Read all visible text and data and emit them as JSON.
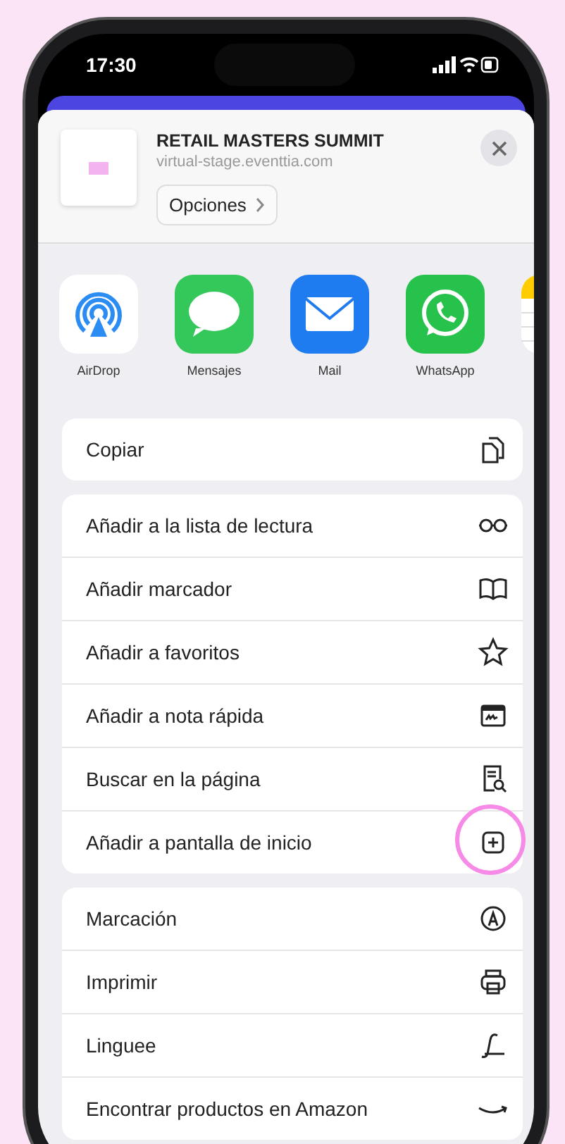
{
  "status_bar": {
    "time": "17:30"
  },
  "header": {
    "title": "RETAIL MASTERS SUMMIT",
    "url": "virtual-stage.eventtia.com",
    "options_button": "Opciones"
  },
  "apps": [
    {
      "kind": "airdrop",
      "label": "AirDrop"
    },
    {
      "kind": "messages",
      "label": "Mensajes"
    },
    {
      "kind": "mail",
      "label": "Mail"
    },
    {
      "kind": "whatsapp",
      "label": "WhatsApp"
    },
    {
      "kind": "notes"
    }
  ],
  "action_groups": [
    {
      "items": [
        {
          "label": "Copiar",
          "kind": "copy",
          "highlighted": false
        }
      ]
    },
    {
      "items": [
        {
          "label": "Añadir a la lista de lectura",
          "kind": "glasses",
          "highlighted": false
        },
        {
          "label": "Añadir marcador",
          "kind": "book",
          "highlighted": false
        },
        {
          "label": "Añadir a favoritos",
          "kind": "star",
          "highlighted": false
        },
        {
          "label": "Añadir a nota rápida",
          "kind": "quicknote",
          "highlighted": false
        },
        {
          "label": "Buscar en la página",
          "kind": "finddoc",
          "highlighted": false
        },
        {
          "label": "Añadir a pantalla de inicio",
          "kind": "addsquare",
          "highlighted": true
        }
      ]
    },
    {
      "items": [
        {
          "label": "Marcación",
          "kind": "markup",
          "highlighted": false
        },
        {
          "label": "Imprimir",
          "kind": "print",
          "highlighted": false
        },
        {
          "label": "Linguee",
          "kind": "linguee",
          "highlighted": false
        },
        {
          "label": "Encontrar productos en Amazon",
          "kind": "amazon",
          "highlighted": false
        }
      ]
    }
  ]
}
